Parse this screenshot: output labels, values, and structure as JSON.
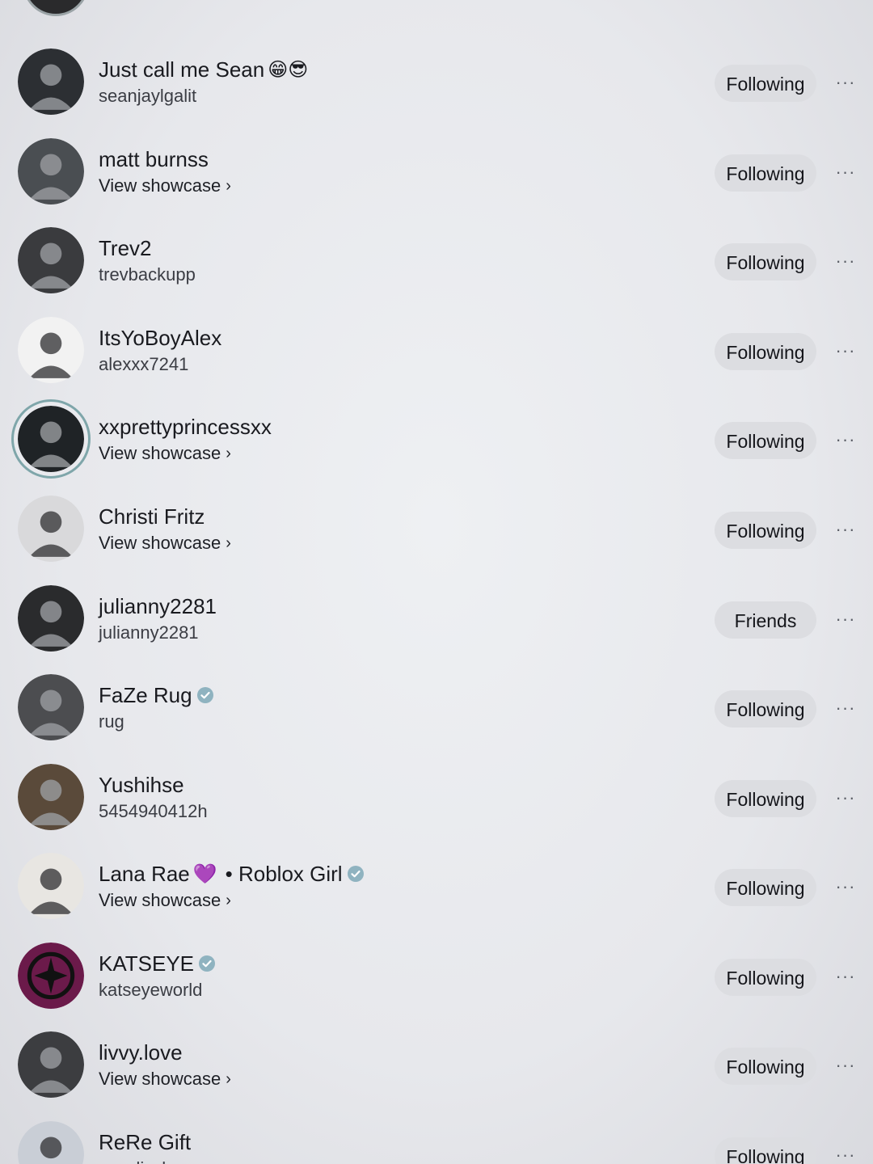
{
  "users": [
    {
      "display": "Just call me Sean",
      "emoji": "😁😎",
      "verified": false,
      "sub": "seanjaylgalit",
      "showcase": false,
      "button": "Following",
      "avatar_color": "#2c2f33"
    },
    {
      "display": "matt burnss",
      "emoji": "",
      "verified": false,
      "sub": "View showcase",
      "showcase": true,
      "button": "Following",
      "avatar_color": "#4a4e52"
    },
    {
      "display": "Trev2",
      "emoji": "",
      "verified": false,
      "sub": "trevbackupp",
      "showcase": false,
      "button": "Following",
      "avatar_color": "#3a3b3e"
    },
    {
      "display": "ItsYoBoyAlex",
      "emoji": "",
      "verified": false,
      "sub": "alexxx7241",
      "showcase": false,
      "button": "Following",
      "avatar_color": "#f2f2f2"
    },
    {
      "display": "xxprettyprincessxx",
      "emoji": "",
      "verified": false,
      "sub": "View showcase",
      "showcase": true,
      "button": "Following",
      "avatar_color": "#1f2326"
    },
    {
      "display": "Christi Fritz",
      "emoji": "",
      "verified": false,
      "sub": "View showcase",
      "showcase": true,
      "button": "Following",
      "avatar_color": "#d9d9db"
    },
    {
      "display": "julianny2281",
      "emoji": "",
      "verified": false,
      "sub": "julianny2281",
      "showcase": false,
      "button": "Friends",
      "avatar_color": "#2a2b2d"
    },
    {
      "display": "FaZe Rug",
      "emoji": "",
      "verified": true,
      "sub": "rug",
      "showcase": false,
      "button": "Following",
      "avatar_color": "#4c4d50"
    },
    {
      "display": "Yushihse",
      "emoji": "",
      "verified": false,
      "sub": "5454940412h",
      "showcase": false,
      "button": "Following",
      "avatar_color": "#5a4a3a"
    },
    {
      "display": "Lana Rae",
      "emoji": "💜",
      "extra": "• Roblox Girl",
      "verified": true,
      "sub": "View showcase",
      "showcase": true,
      "button": "Following",
      "avatar_color": "#e8e6e2"
    },
    {
      "display": "KATSEYE",
      "emoji": "",
      "verified": true,
      "sub": "katseyeworld",
      "showcase": false,
      "button": "Following",
      "avatar_color": "#6b1a4a"
    },
    {
      "display": "livvy.love",
      "emoji": "",
      "verified": false,
      "sub": "View showcase",
      "showcase": true,
      "button": "Following",
      "avatar_color": "#3c3d40"
    },
    {
      "display": "ReRe Gift",
      "emoji": "",
      "verified": false,
      "sub": "rerediyshop",
      "showcase": false,
      "button": "Following",
      "avatar_color": "#c9ced6"
    }
  ],
  "more_label": "···",
  "colors": {
    "background": "#e6e7eb",
    "button_bg": "#dcdde1",
    "verified": "#8fb3c0",
    "story_ring": "#7fa6aa"
  }
}
